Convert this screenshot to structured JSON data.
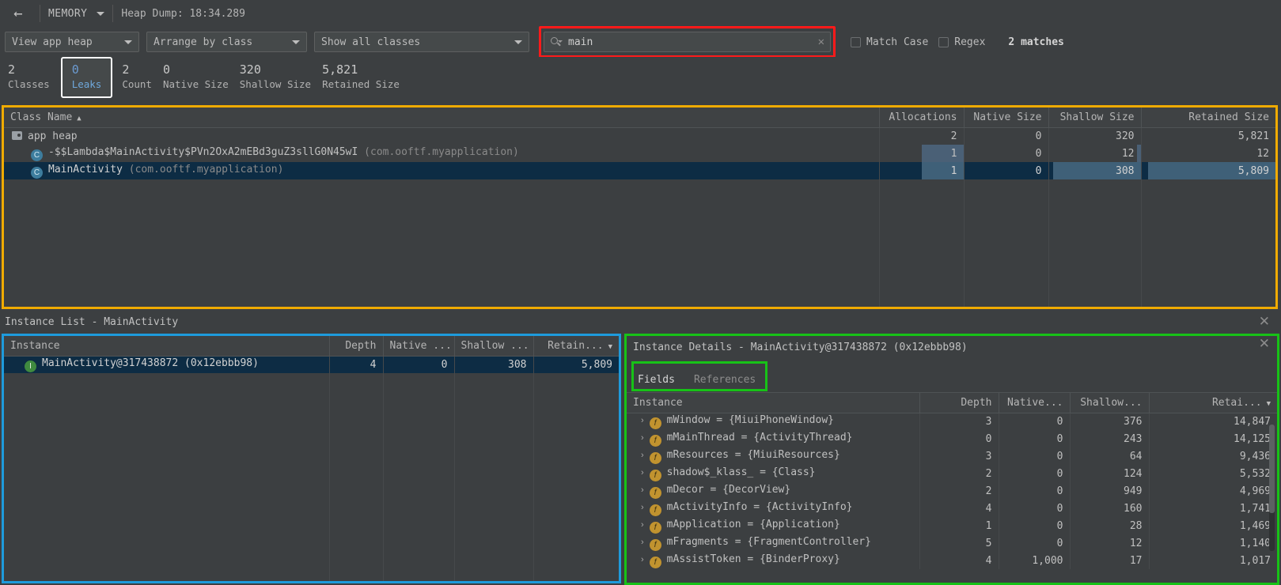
{
  "topbar": {
    "back_icon": "arrow-left-icon",
    "tool_name": "MEMORY",
    "heap_dump": "Heap Dump: 18:34.289"
  },
  "toolbar": {
    "heap_select": "View app heap",
    "arrange_select": "Arrange by class",
    "classes_select": "Show all classes",
    "search_value": "main",
    "search_placeholder": "",
    "clear_label": "✕",
    "match_case_label": "Match Case",
    "regex_label": "Regex",
    "matches_label": "2 matches"
  },
  "stats": [
    {
      "value": "2",
      "label": "Classes"
    },
    {
      "value": "0",
      "label": "Leaks"
    },
    {
      "value": "2",
      "label": "Count"
    },
    {
      "value": "0",
      "label": "Native Size"
    },
    {
      "value": "320",
      "label": "Shallow Size"
    },
    {
      "value": "5,821",
      "label": "Retained Size"
    }
  ],
  "class_table": {
    "columns": [
      "Class Name",
      "Allocations",
      "Native Size",
      "Shallow Size",
      "Retained Size"
    ],
    "sort_indicator": "▲",
    "rows": [
      {
        "icon": "heap-icon",
        "name": "app heap",
        "package": "",
        "allocations": "2",
        "native": "0",
        "shallow": "320",
        "retained": "5,821",
        "selected": false,
        "indent": 1
      },
      {
        "icon": "class-icon",
        "name": "-$$Lambda$MainActivity$PVn2OxA2mEBd3guZ3sllG0N45wI",
        "package": "(com.ooftf.myapplication)",
        "allocations": "1",
        "native": "0",
        "shallow": "12",
        "retained": "12",
        "selected": false,
        "indent": 2
      },
      {
        "icon": "class-icon",
        "name": "MainActivity",
        "package": "(com.ooftf.myapplication)",
        "allocations": "1",
        "native": "0",
        "shallow": "308",
        "retained": "5,809",
        "selected": true,
        "indent": 2
      }
    ]
  },
  "instance_list": {
    "title": "Instance List - MainActivity",
    "close_label": "✕",
    "columns": [
      "Instance",
      "Depth",
      "Native ...",
      "Shallow ...",
      "Retain..."
    ],
    "sort_indicator": "▼",
    "rows": [
      {
        "icon": "instance-icon",
        "name": "MainActivity@317438872 (0x12ebbb98)",
        "depth": "4",
        "native": "0",
        "shallow": "308",
        "retained": "5,809",
        "selected": true
      }
    ]
  },
  "instance_details": {
    "title": "Instance Details - MainActivity@317438872 (0x12ebbb98)",
    "close_label": "✕",
    "tabs": [
      {
        "label": "Fields",
        "active": true
      },
      {
        "label": "References",
        "active": false
      }
    ],
    "columns": [
      "Instance",
      "Depth",
      "Native...",
      "Shallow...",
      "Retai..."
    ],
    "sort_indicator": "▼",
    "expand_icon": "›",
    "rows": [
      {
        "name": "mWindow = {MiuiPhoneWindow}",
        "depth": "3",
        "native": "0",
        "shallow": "376",
        "retained": "14,847"
      },
      {
        "name": "mMainThread = {ActivityThread}",
        "depth": "0",
        "native": "0",
        "shallow": "243",
        "retained": "14,125"
      },
      {
        "name": "mResources = {MiuiResources}",
        "depth": "3",
        "native": "0",
        "shallow": "64",
        "retained": "9,436"
      },
      {
        "name": "shadow$_klass_ = {Class}",
        "depth": "2",
        "native": "0",
        "shallow": "124",
        "retained": "5,532"
      },
      {
        "name": "mDecor = {DecorView}",
        "depth": "2",
        "native": "0",
        "shallow": "949",
        "retained": "4,969"
      },
      {
        "name": "mActivityInfo = {ActivityInfo}",
        "depth": "4",
        "native": "0",
        "shallow": "160",
        "retained": "1,741"
      },
      {
        "name": "mApplication = {Application}",
        "depth": "1",
        "native": "0",
        "shallow": "28",
        "retained": "1,469"
      },
      {
        "name": "mFragments = {FragmentController}",
        "depth": "5",
        "native": "0",
        "shallow": "12",
        "retained": "1,140"
      },
      {
        "name": "mAssistToken = {BinderProxy}",
        "depth": "4",
        "native": "1,000",
        "shallow": "17",
        "retained": "1,017"
      }
    ]
  },
  "colors": {
    "highlight_search": "#ff1a1a",
    "highlight_class_table": "#f0ab00",
    "highlight_instance_list": "#1e9bdc",
    "highlight_details": "#17c217",
    "highlight_leaks": "#ffffff",
    "selection": "#0d2c44",
    "accent": "#4a88c7"
  }
}
